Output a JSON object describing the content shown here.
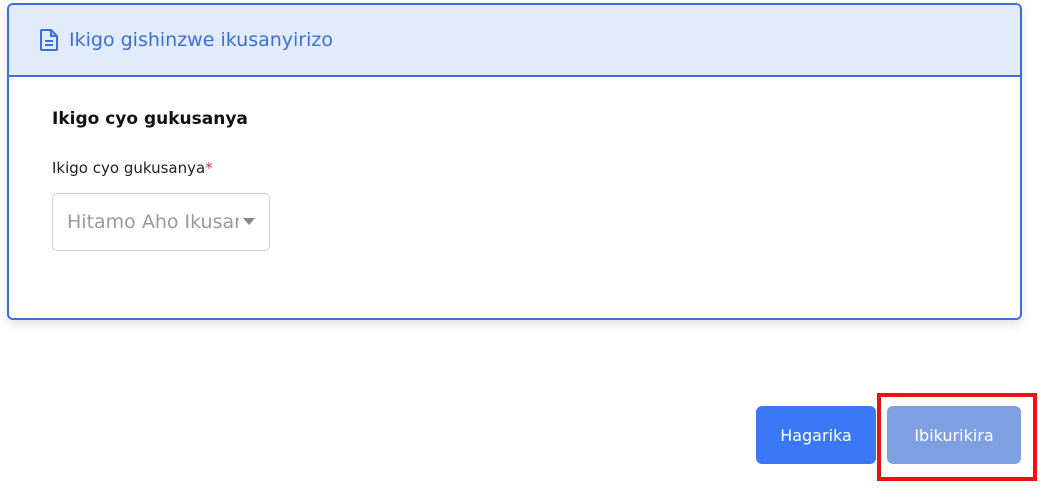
{
  "card": {
    "title": "Ikigo gishinzwe ikusanyirizo",
    "icon": "document-icon",
    "accent_color": "#3d6fd8",
    "header_bg": "#e1ebfb"
  },
  "form": {
    "section_title": "Ikigo cyo gukusanya",
    "field_label": "Ikigo cyo gukusanya",
    "required_marker": "*",
    "select_placeholder": "Hitamo Aho Ikusanyirizo"
  },
  "actions": {
    "cancel_label": "Hagarika",
    "submit_label": "Ibikurikira",
    "cancel_color": "#3b78f7",
    "submit_color": "#7f9fe3",
    "highlight_color": "#ef1111"
  }
}
